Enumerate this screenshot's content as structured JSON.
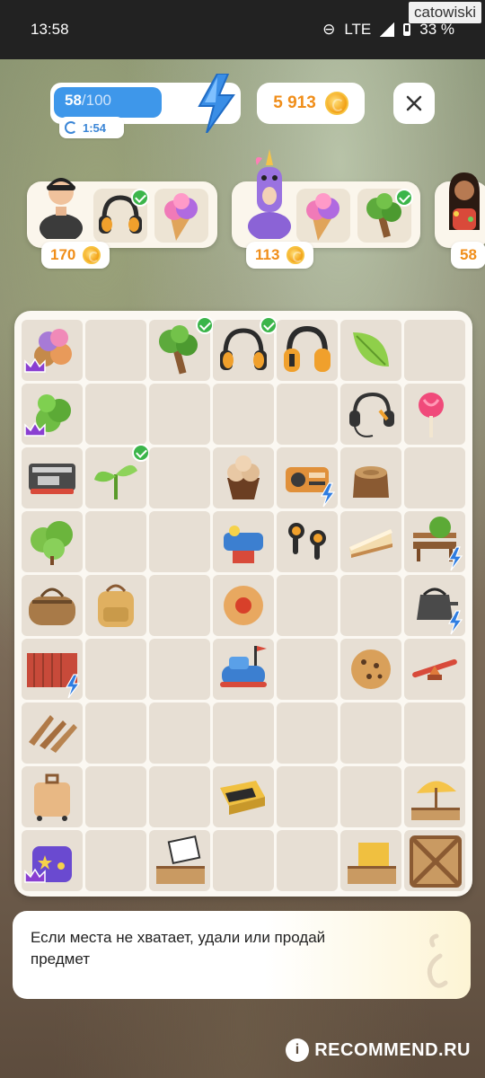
{
  "status": {
    "time": "13:58",
    "network": "LTE",
    "battery": "33 %",
    "watermark": "catowiski"
  },
  "energy": {
    "current": "58",
    "max": "/100",
    "timer": "1:54",
    "level": 0.58
  },
  "coins": {
    "value": "5 913"
  },
  "orders": [
    {
      "character": "man-in-cap",
      "reward": "170",
      "items": [
        "headphones",
        "ice-cream"
      ],
      "checked": [
        true,
        false
      ]
    },
    {
      "character": "unicorn-costume",
      "reward": "113",
      "items": [
        "ice-cream",
        "tree"
      ],
      "checked": [
        false,
        true
      ]
    },
    {
      "character": "hawaiian-girl",
      "reward": "58",
      "items": [],
      "checked": []
    }
  ],
  "board": {
    "rows": [
      [
        {
          "item": "ice-cream-stack",
          "lock": "crown"
        },
        {
          "item": ""
        },
        {
          "item": "tree",
          "check": true
        },
        {
          "item": "headphones",
          "check": true
        },
        {
          "item": "headphones-orange"
        },
        {
          "item": "leaf"
        },
        {
          "item": ""
        }
      ],
      [
        {
          "item": "shrub",
          "lock": "crown"
        },
        {
          "item": ""
        },
        {
          "item": ""
        },
        {
          "item": ""
        },
        {
          "item": ""
        },
        {
          "item": "headphones-wired"
        },
        {
          "item": "lollipop"
        }
      ],
      [
        {
          "item": "toaster"
        },
        {
          "item": "sprout",
          "check": true
        },
        {
          "item": ""
        },
        {
          "item": "cupcake"
        },
        {
          "item": "radio",
          "lock": "bolt"
        },
        {
          "item": "stump"
        },
        {
          "item": ""
        }
      ],
      [
        {
          "item": "bush"
        },
        {
          "item": ""
        },
        {
          "item": ""
        },
        {
          "item": "kiddie-car"
        },
        {
          "item": "earbuds"
        },
        {
          "item": "cheesecake"
        },
        {
          "item": "garden-bench",
          "lock": "bolt"
        }
      ],
      [
        {
          "item": "duffel-bag"
        },
        {
          "item": "backpack"
        },
        {
          "item": ""
        },
        {
          "item": "jam-cookie"
        },
        {
          "item": ""
        },
        {
          "item": ""
        },
        {
          "item": "kettle",
          "lock": "bolt"
        }
      ],
      [
        {
          "item": "shipping-container",
          "lock": "bolt"
        },
        {
          "item": ""
        },
        {
          "item": ""
        },
        {
          "item": "bumper-car"
        },
        {
          "item": ""
        },
        {
          "item": "chocolate-cookie"
        },
        {
          "item": "seesaw"
        }
      ],
      [
        {
          "item": "deck-chair"
        },
        {
          "item": ""
        },
        {
          "item": ""
        },
        {
          "item": ""
        },
        {
          "item": ""
        },
        {
          "item": ""
        },
        {
          "item": ""
        }
      ],
      [
        {
          "item": "suitcase"
        },
        {
          "item": ""
        },
        {
          "item": ""
        },
        {
          "item": "gold-box"
        },
        {
          "item": ""
        },
        {
          "item": ""
        },
        {
          "item": "beach-umbrella-crate"
        }
      ],
      [
        {
          "item": "starry-suitcase",
          "lock": "crown"
        },
        {
          "item": ""
        },
        {
          "item": "picture-crate"
        },
        {
          "item": ""
        },
        {
          "item": ""
        },
        {
          "item": "gold-crate"
        },
        {
          "item": "wooden-crate"
        }
      ]
    ]
  },
  "hint": {
    "text": "Если места не хватает, удали или продай предмет"
  },
  "footer": {
    "watermark": "RECOMMEND.RU"
  },
  "colors": {
    "accent": "#3e97ea",
    "coin": "#f08e1a",
    "check": "#3bb54a",
    "crown": "#8a3fd1",
    "bolt": "#2f7de1"
  }
}
